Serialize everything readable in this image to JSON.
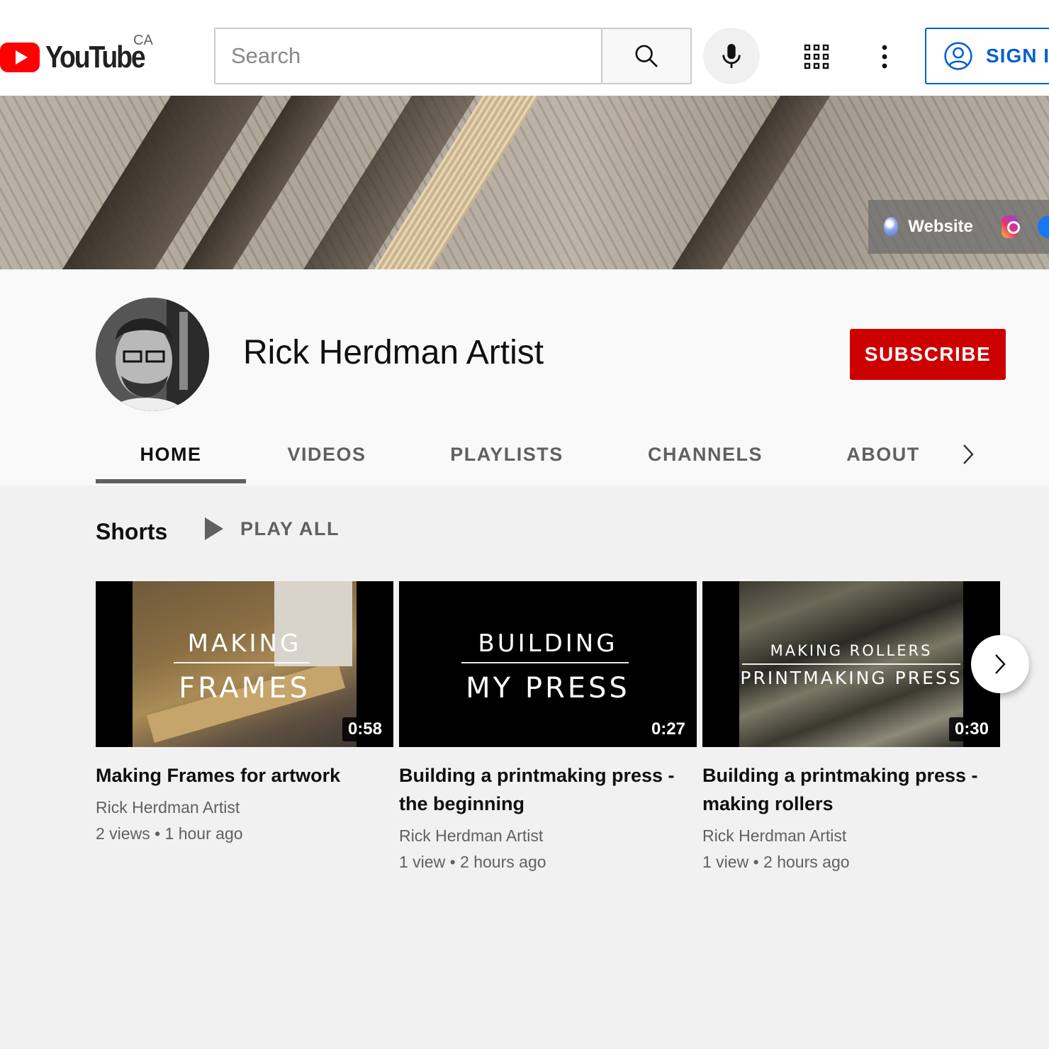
{
  "header": {
    "logo_text": "YouTube",
    "region": "CA",
    "search_placeholder": "Search",
    "sign_in_label": "SIGN IN",
    "colors": {
      "brand": "#ff0000",
      "link": "#065fd4"
    }
  },
  "banner": {
    "website_label": "Website",
    "icons": [
      "globe-icon",
      "instagram-icon",
      "facebook-icon"
    ]
  },
  "channel": {
    "name": "Rick Herdman Artist",
    "subscribe_label": "SUBSCRIBE",
    "subscribe_color": "#cc0000"
  },
  "tabs": [
    {
      "label": "HOME",
      "active": true
    },
    {
      "label": "VIDEOS",
      "active": false
    },
    {
      "label": "PLAYLISTS",
      "active": false
    },
    {
      "label": "CHANNELS",
      "active": false
    },
    {
      "label": "ABOUT",
      "active": false
    }
  ],
  "shelf": {
    "title": "Shorts",
    "play_all_label": "PLAY ALL",
    "videos": [
      {
        "thumb_line1": "MAKING",
        "thumb_line2": "FRAMES",
        "duration": "0:58",
        "title": "Making Frames for artwork",
        "channel": "Rick Herdman Artist",
        "views": "2 views",
        "age": "1 hour ago"
      },
      {
        "thumb_line1": "BUILDING",
        "thumb_line2": "MY PRESS",
        "duration": "0:27",
        "title": "Building a printmaking press - the beginning",
        "channel": "Rick Herdman Artist",
        "views": "1 view",
        "age": "2 hours ago"
      },
      {
        "thumb_line1": "MAKING ROLLERS",
        "thumb_line2": "PRINTMAKING PRESS",
        "duration": "0:30",
        "title": "Building a printmaking press - making rollers",
        "channel": "Rick Herdman Artist",
        "views": "1 view",
        "age": "2 hours ago"
      }
    ]
  }
}
